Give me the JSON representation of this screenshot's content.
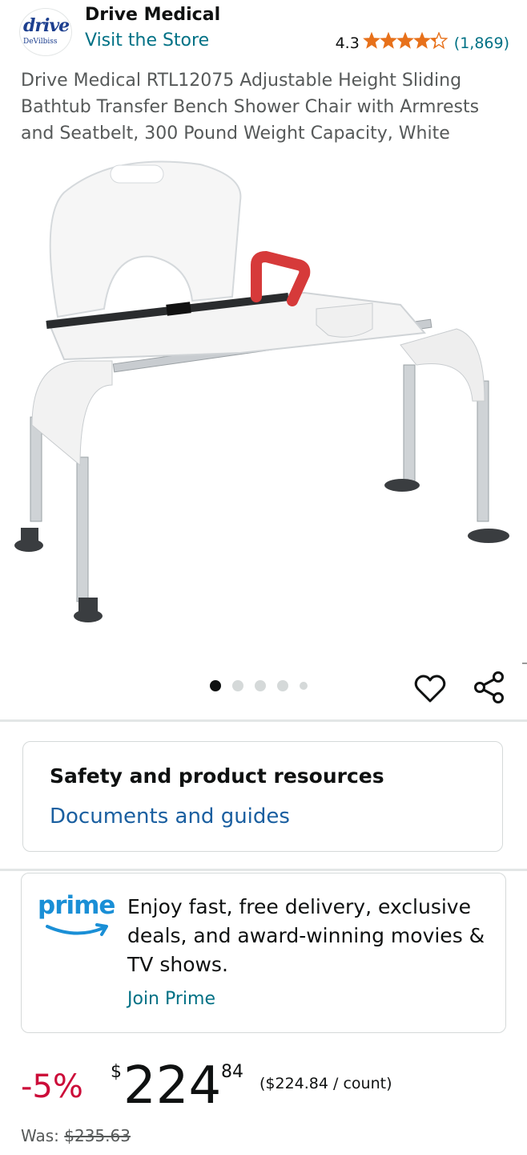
{
  "brand": {
    "logo_text": "drive",
    "logo_subtext": "DeVilbiss",
    "name": "Drive Medical",
    "store_link": "Visit the Store"
  },
  "rating": {
    "value": "4.3",
    "stars": 4.3,
    "count": "(1,869)"
  },
  "product": {
    "title": "Drive Medical RTL12075 Adjustable Height Sliding Bathtub Transfer Bench Shower Chair with Armrests and Seatbelt, 300 Pound Weight Capacity, White"
  },
  "carousel": {
    "count": 5,
    "active_index": 0
  },
  "icons": {
    "wishlist": "heart-icon",
    "share": "share-icon"
  },
  "safety": {
    "title": "Safety and product resources",
    "link": "Documents and guides"
  },
  "prime": {
    "logo": "prime",
    "text": "Enjoy fast, free delivery, exclusive deals, and award-winning movies & TV shows.",
    "link": "Join Prime"
  },
  "price": {
    "discount": "-5%",
    "currency": "$",
    "whole": "224",
    "fraction": "84",
    "unit": "($224.84 / count)",
    "was_label": "Was:",
    "was_value": "$235.63"
  },
  "colors": {
    "link": "#007185",
    "discount": "#cc0c39",
    "star": "#e7711b",
    "prime": "#1a8fd6"
  }
}
